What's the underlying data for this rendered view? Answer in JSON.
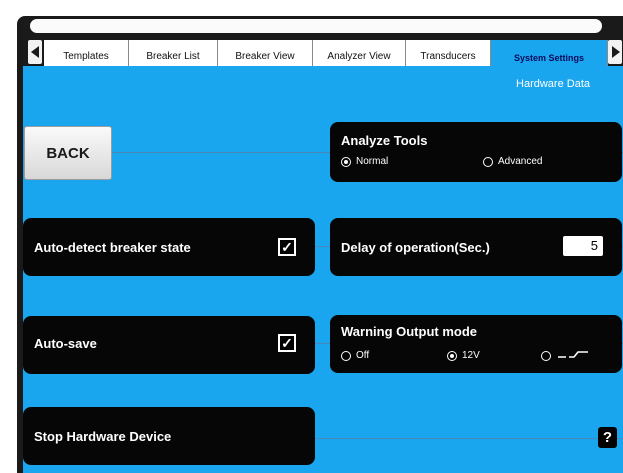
{
  "tabs": [
    {
      "label": "Templates"
    },
    {
      "label": "Breaker List"
    },
    {
      "label": "Breaker View"
    },
    {
      "label": "Analyzer View"
    },
    {
      "label": "Transducers"
    },
    {
      "label": "System Settings"
    }
  ],
  "subtitle": "Hardware Data",
  "back_label": "BACK",
  "analyze_tools": {
    "title": "Analyze Tools",
    "options": [
      {
        "label": "Normal",
        "selected": true
      },
      {
        "label": "Advanced",
        "selected": false
      }
    ]
  },
  "auto_detect": {
    "label": "Auto-detect breaker state",
    "checked": true,
    "mark": "✓"
  },
  "delay": {
    "label": "Delay of operation(Sec.)",
    "value": "5"
  },
  "auto_save": {
    "label": "Auto-save",
    "checked": true,
    "mark": "✓"
  },
  "warning_output": {
    "title": "Warning Output mode",
    "options": [
      {
        "label": "Off",
        "selected": false
      },
      {
        "label": "12V",
        "selected": true
      },
      {
        "label": "",
        "selected": false
      }
    ]
  },
  "stop_hardware": {
    "label": "Stop Hardware Device"
  },
  "help_label": "?",
  "colors": {
    "background": "#1aa6ee",
    "panel": "#060606",
    "bezel": "#1a1a1a"
  },
  "icons": [
    "chevron-left-icon",
    "chevron-right-icon",
    "checkbox-checked-icon",
    "radio-icon",
    "pulse-symbol-icon",
    "help-icon"
  ]
}
